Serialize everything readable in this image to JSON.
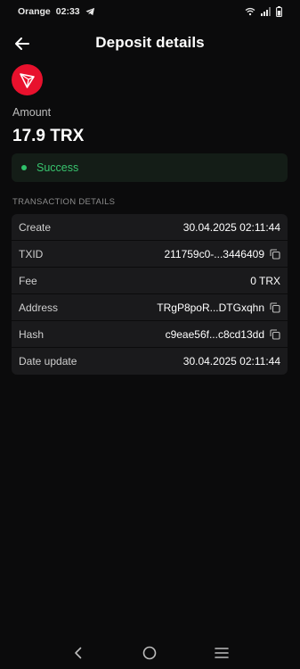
{
  "status_bar": {
    "carrier": "Orange",
    "time": "02:33"
  },
  "header": {
    "title": "Deposit details"
  },
  "asset": {
    "icon": "tron-icon",
    "brand_color": "#e8112d"
  },
  "amount": {
    "label": "Amount",
    "value": "17.9 TRX"
  },
  "status": {
    "text": "Success",
    "color": "#38c46e"
  },
  "section": {
    "label": "TRANSACTION DETAILS"
  },
  "details": [
    {
      "key": "Create",
      "value": "30.04.2025 02:11:44",
      "copy": false
    },
    {
      "key": "TXID",
      "value": "211759c0-...3446409",
      "copy": true
    },
    {
      "key": "Fee",
      "value": "0 TRX",
      "copy": false
    },
    {
      "key": "Address",
      "value": "TRgP8poR...DTGxqhn",
      "copy": true
    },
    {
      "key": "Hash",
      "value": "c9eae56f...c8cd13dd",
      "copy": true
    },
    {
      "key": "Date update",
      "value": "30.04.2025 02:11:44",
      "copy": false
    }
  ],
  "nav": {
    "icons": [
      "back-nav-icon",
      "home-nav-icon",
      "recents-nav-icon"
    ]
  }
}
